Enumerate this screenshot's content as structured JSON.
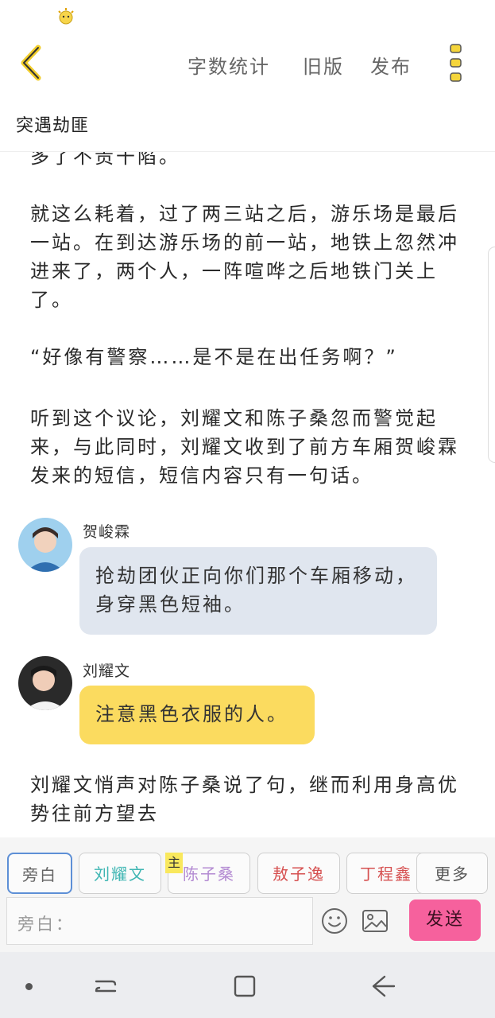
{
  "status_bar": {
    "icon": "lightbulb-sticker-icon"
  },
  "header": {
    "back_icon": "chevron-left-icon",
    "word_count": "字数统计",
    "old_version": "旧版",
    "publish": "发布",
    "more_icon": "three-dots-vertical-icon",
    "title": "突遇劫匪"
  },
  "content": {
    "para0": "多了不责干陷。",
    "para1": "就这么耗着，过了两三站之后，游乐场是最后一站。在到达游乐场的前一站，地铁上忽然冲进来了，两个人，一阵喧哗之后地铁门关上了。",
    "para2": "“好像有警察……是不是在出任务啊？”",
    "para3": "听到这个议论，刘耀文和陈子桑忽而警觉起来，与此同时，刘耀文收到了前方车厢贺峻霖发来的短信，短信内容只有一句话。",
    "messages": [
      {
        "name": "贺峻霖",
        "text": "抢劫团伙正向你们那个车厢移动，身穿黑色短袖。"
      },
      {
        "name": "刘耀文",
        "text": "注意黑色衣服的人。"
      }
    ],
    "para4": "刘耀文悄声对陈子桑说了句，继而利用身高优势往前方望去"
  },
  "roles": {
    "items": [
      "旁白",
      "刘耀文",
      "陈子桑",
      "敖子逸",
      "丁程鑫"
    ],
    "main_tag": "主",
    "more": "更多"
  },
  "composer": {
    "placeholder": "旁白：",
    "emoji_icon": "emoji-smile-icon",
    "image_icon": "image-picture-icon",
    "send": "发送"
  },
  "colors": {
    "accent_yellow": "#f5d53b",
    "bubble_gray": "#e0e6ef",
    "bubble_yellow": "#fbdb5f",
    "send_pink": "#f6619d",
    "selected_border": "#5d8fd6"
  },
  "nav": {
    "recent": "recent-apps-icon",
    "home": "home-icon",
    "back": "back-icon"
  }
}
